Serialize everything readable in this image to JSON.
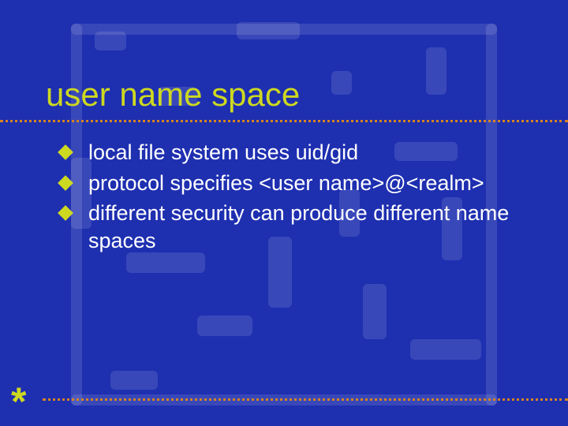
{
  "slide": {
    "title": "user name space",
    "bullets": [
      "local file system uses uid/gid",
      "protocol specifies <user name>@<realm>",
      "different security can produce different name spaces"
    ],
    "decor": {
      "asterisk": "*"
    }
  },
  "colors": {
    "background": "#1e2fb0",
    "title": "#cdd820",
    "bullet_icon": "#cdd820",
    "rule": "#d7841f",
    "body_text": "#ffffff"
  }
}
